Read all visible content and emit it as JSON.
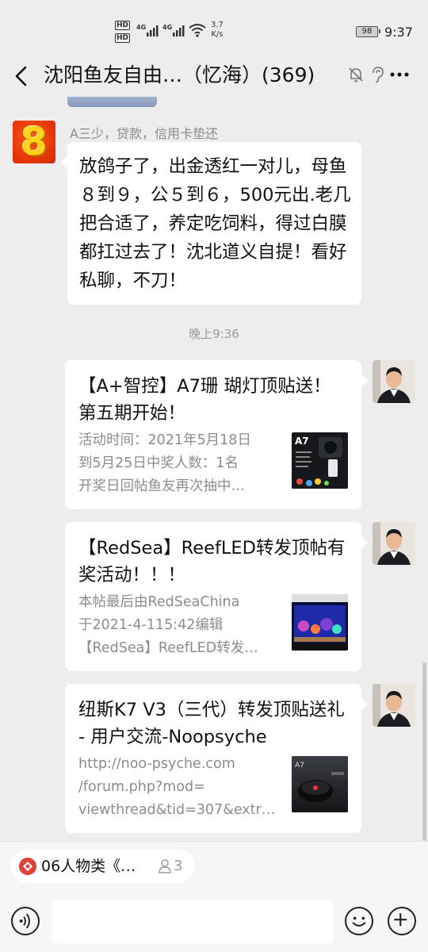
{
  "status": {
    "hd1": "HD",
    "hd2": "HD",
    "net1": "4G",
    "net2": "4G",
    "speed_value": "3.7",
    "speed_unit": "K/s",
    "battery": "98",
    "time": "9:37"
  },
  "nav": {
    "title": "沈阳鱼友自由…（忆海）(369)"
  },
  "messages": {
    "incoming": {
      "sender": "A三少，贷款，信用卡垫还",
      "avatar_glyph": "8",
      "text": "放鸽子了，出金透红一对儿，母鱼８到９，公５到６，500元出.老几把合适了，养定吃饲料，得过白膜都扛过去了！沈北道义自提！看好私聊，不刀！"
    },
    "time_separator": "晚上9:36",
    "cards": [
      {
        "title": "【A+智控】A7珊 瑚灯顶贴送！第五期开始！",
        "desc": [
          "活动时间：2021年5月18日",
          "到5月25日中奖人数：1名",
          "开奖日回帖鱼友再次抽中…"
        ],
        "thumb_text": "A7"
      },
      {
        "title": "【RedSea】ReefLED转发顶帖有奖活动！！！",
        "desc": [
          "本帖最后由RedSeaChina",
          "于2021-4-115:42编辑",
          "【RedSea】ReefLED转发…"
        ],
        "thumb_text": ""
      },
      {
        "title": "纽斯K7 V3（三代）转发顶贴送礼 - 用户交流-Noopsyche",
        "desc": [
          "http://noo-psyche.com",
          "/forum.php?mod=",
          "viewthread&tid=307&extr…"
        ],
        "thumb_text": "A7"
      }
    ]
  },
  "bottom": {
    "topic_label": "06人物类《…",
    "topic_count": "3",
    "input_value": ""
  },
  "colors": {
    "background": "#ededed",
    "bubble": "#ffffff",
    "secondary_text": "#8c8c8c"
  }
}
